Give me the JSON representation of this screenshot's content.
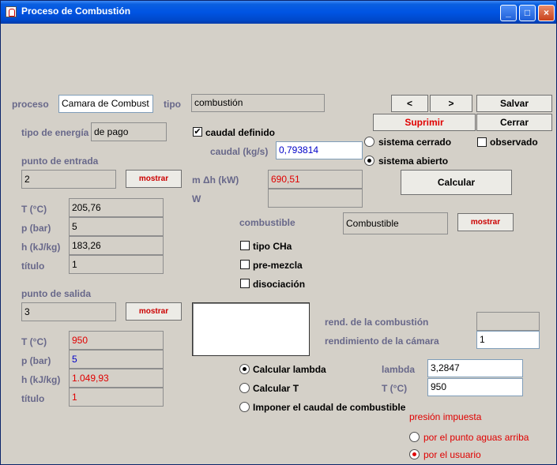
{
  "window": {
    "title": "Proceso de Combustión",
    "min": "_",
    "max": "□",
    "close": "×"
  },
  "proceso": {
    "label": "proceso",
    "value": "Camara de Combust"
  },
  "tipo": {
    "label": "tipo",
    "value": "combustión"
  },
  "nav": {
    "prev": "<",
    "next": ">"
  },
  "buttons": {
    "salvar": "Salvar",
    "suprimir": "Suprimir",
    "cerrar": "Cerrar",
    "calcular": "Calcular",
    "mostrar": "mostrar"
  },
  "energia": {
    "label": "tipo de energía",
    "value": "de pago"
  },
  "caudal_definido": {
    "label": "caudal definido",
    "checked": true
  },
  "caudal": {
    "label": "caudal (kg/s)",
    "value": "0,793814"
  },
  "sistema": {
    "cerrado": "sistema cerrado",
    "abierto": "sistema abierto",
    "selected": "abierto"
  },
  "observado": {
    "label": "observado",
    "checked": false
  },
  "entrada": {
    "title": "punto de entrada",
    "punto": "2",
    "rows": [
      {
        "label": "T (°C)",
        "value": "205,76"
      },
      {
        "label": "p (bar)",
        "value": "5"
      },
      {
        "label": "h (kJ/kg)",
        "value": "183,26"
      },
      {
        "label": "título",
        "value": "1"
      }
    ]
  },
  "mdh": {
    "label": "m Δh (kW)",
    "value": "690,51"
  },
  "w": {
    "label": "W",
    "value": ""
  },
  "combustible": {
    "label": "combustible",
    "value": "Combustible"
  },
  "options": {
    "tipo_cha": "tipo CHa",
    "pre_mezcla": "pre-mezcla",
    "disociacion": "disociación"
  },
  "salida": {
    "title": "punto de salida",
    "punto": "3",
    "rows": [
      {
        "label": "T (°C)",
        "value": "950"
      },
      {
        "label": "p (bar)",
        "value": "5"
      },
      {
        "label": "h (kJ/kg)",
        "value": "1.049,93"
      },
      {
        "label": "título",
        "value": "1"
      }
    ]
  },
  "rend_combustion": {
    "label": "rend. de la combustión",
    "value": ""
  },
  "rend_camara": {
    "label": "rendimiento de la cámara",
    "value": "1"
  },
  "calc": {
    "lambda": "Calcular lambda",
    "t": "Calcular T",
    "imponer": "Imponer el caudal de combustible",
    "selected": "lambda"
  },
  "lambda": {
    "label": "lambda",
    "value": "3,2847"
  },
  "t_out": {
    "label": "T (°C)",
    "value": "950"
  },
  "presion": {
    "title": "presión impuesta",
    "aguas": "por el punto aguas arriba",
    "usuario": "por el usuario",
    "selected": "usuario"
  }
}
